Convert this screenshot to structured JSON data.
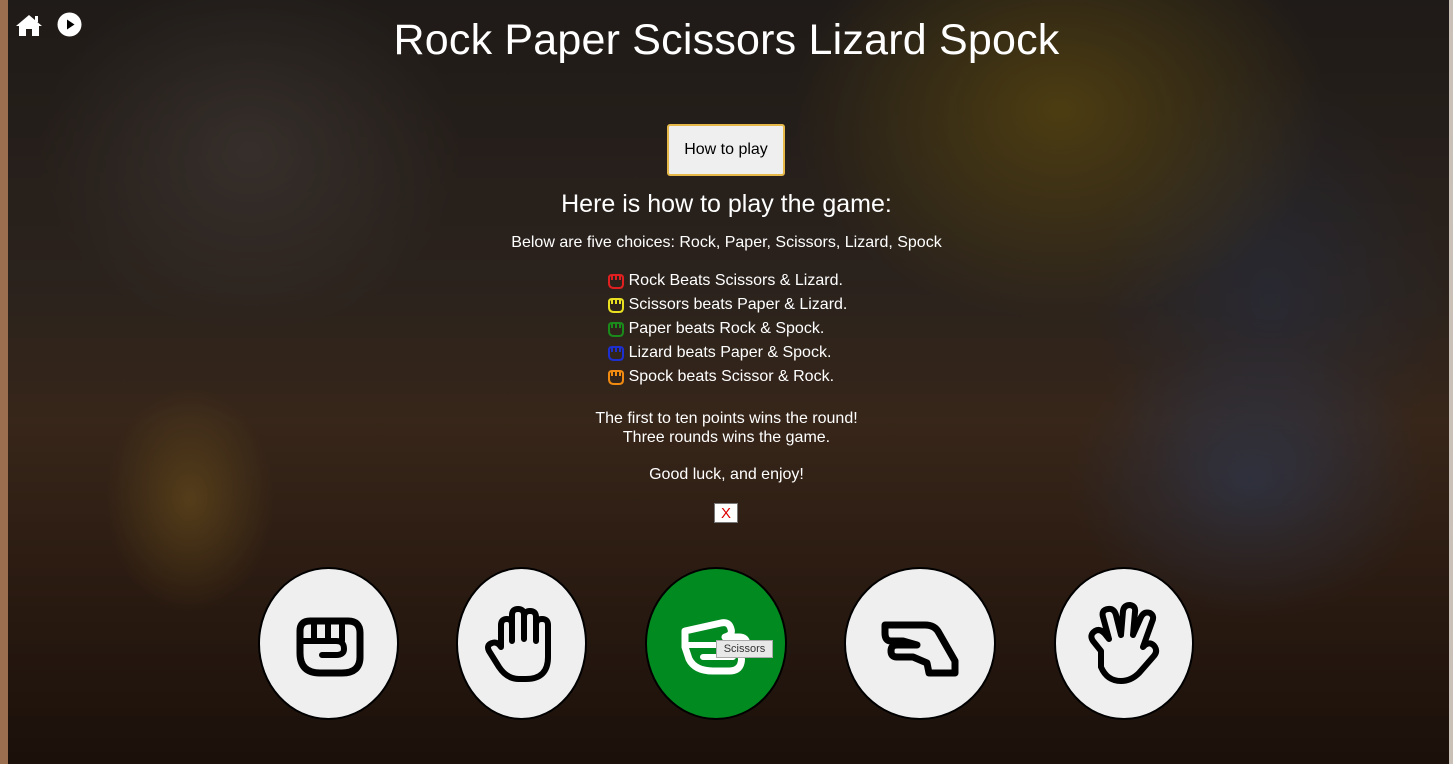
{
  "nav": {
    "home_icon": "home-icon",
    "play_icon": "play-circle-icon"
  },
  "title": "Rock Paper Scissors Lizard Spock",
  "how_to_play_button": "How to play",
  "rules": {
    "heading": "Here is how to play the game:",
    "intro": "Below are five choices: Rock, Paper, Scissors, Lizard, Spock",
    "items": [
      {
        "text": "Rock Beats Scissors & Lizard.",
        "color": "#e02020"
      },
      {
        "text": "Scissors beats Paper & Lizard.",
        "color": "#e8e020"
      },
      {
        "text": "Paper beats Rock & Spock.",
        "color": "#1a8a1a"
      },
      {
        "text": "Lizard beats Paper & Spock.",
        "color": "#1e2fd0"
      },
      {
        "text": "Spock beats Scissor & Rock.",
        "color": "#f08a10"
      }
    ],
    "win_line1": "The first to ten points wins the round!",
    "win_line2": "Three rounds wins the game.",
    "good_luck": "Good luck, and enjoy!",
    "close_label": "X"
  },
  "choices": [
    {
      "name": "rock",
      "icon": "hand-rock-icon",
      "active": false
    },
    {
      "name": "paper",
      "icon": "hand-paper-icon",
      "active": false
    },
    {
      "name": "scissors",
      "icon": "hand-scissors-icon",
      "active": true
    },
    {
      "name": "lizard",
      "icon": "hand-lizard-icon",
      "active": false
    },
    {
      "name": "spock",
      "icon": "hand-spock-icon",
      "active": false
    }
  ],
  "tooltip": "Scissors",
  "colors": {
    "active_choice": "#008a1f",
    "choice_bg": "#efefef",
    "button_border": "#e6b84a",
    "close_text": "#dd0000"
  }
}
